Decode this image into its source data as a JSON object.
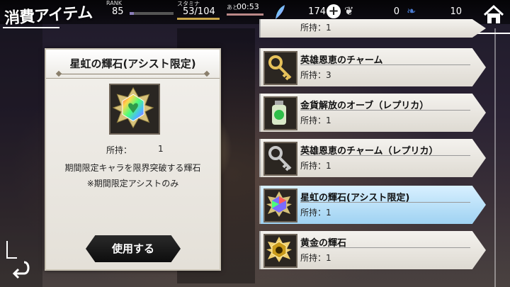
{
  "header": {
    "title": "消費アイテム",
    "rank_label": "RANK",
    "rank_value": "85",
    "rank_progress": 0.1,
    "stamina_label": "スタミナ",
    "stamina_value": "53/104",
    "timer_label": "あと",
    "timer_value": "00:53",
    "gem_count": "174",
    "currency2_count": "0",
    "currency3_count": "10",
    "add_icon": "plus-icon",
    "home_icon": "home-icon"
  },
  "detail": {
    "name": "星虹の輝石(アシスト限定)",
    "own_label": "所持：",
    "own_value": "1",
    "description_line1": "期間限定キャラを限界突破する輝石",
    "description_line2": "※期間限定アシストのみ",
    "use_button": "使用する"
  },
  "list": {
    "partial_count": "所持：1",
    "items": [
      {
        "name": "英雄恩恵のチャーム",
        "count": "所持：3",
        "icon": "gold-key-icon",
        "selected": false
      },
      {
        "name": "金貨解放のオーブ（レプリカ）",
        "count": "所持：1",
        "icon": "green-bottle-icon",
        "selected": false
      },
      {
        "name": "英雄恩恵のチャーム（レプリカ）",
        "count": "所持：1",
        "icon": "silver-key-icon",
        "selected": false
      },
      {
        "name": "星虹の輝石(アシスト限定)",
        "count": "所持：1",
        "icon": "rainbow-gem-icon",
        "selected": true
      },
      {
        "name": "黄金の輝石",
        "count": "所持：1",
        "icon": "gold-gem-icon",
        "selected": false
      }
    ]
  },
  "colors": {
    "selected_row": "#9fd2f2",
    "accent": "#c9a64a"
  }
}
